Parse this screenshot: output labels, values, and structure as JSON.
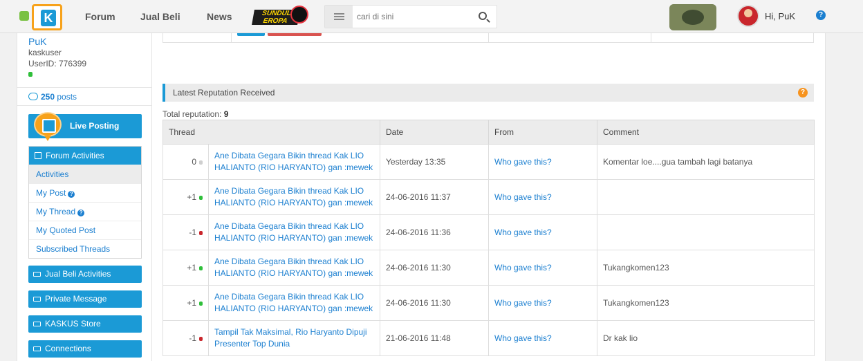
{
  "header": {
    "logo_icon": "kaskus-logo",
    "nav": [
      "Forum",
      "Jual Beli",
      "News"
    ],
    "promo_text": "SUNDUL EROPA",
    "search": {
      "placeholder": "cari di sini"
    },
    "greeting": "Hi, PuK",
    "help_icon": "?"
  },
  "sidebar": {
    "username": "PuK",
    "rank": "kaskuser",
    "user_id": "UserID: 776399",
    "posts_count": "250",
    "posts_label": "posts",
    "live_posting": "Live Posting",
    "forum_activities": {
      "title": "Forum Activities",
      "items": [
        "Activities",
        "My Post",
        "My Thread",
        "My Quoted Post",
        "Subscribed Threads"
      ]
    },
    "buttons": [
      "Jual Beli Activities",
      "Private Message",
      "KASKUS Store",
      "Connections"
    ]
  },
  "main": {
    "section_title": "Latest Reputation Received",
    "total_label": "Total reputation:",
    "total_value": "9",
    "columns": [
      "Thread",
      "Date",
      "From",
      "Comment"
    ],
    "rows": [
      {
        "score": "0",
        "status": "gray",
        "thread": "Ane Dibata Gegara Bikin thread Kak LIO HALIANTO (RIO HARYANTO) gan :mewek",
        "date": "Yesterday 13:35",
        "from": "Who gave this?",
        "comment": "Komentar loe....gua tambah lagi batanya"
      },
      {
        "score": "+1",
        "status": "green",
        "thread": "Ane Dibata Gegara Bikin thread Kak LIO HALIANTO (RIO HARYANTO) gan :mewek",
        "date": "24-06-2016 11:37",
        "from": "Who gave this?",
        "comment": ""
      },
      {
        "score": "-1",
        "status": "red",
        "thread": "Ane Dibata Gegara Bikin thread Kak LIO HALIANTO (RIO HARYANTO) gan :mewek",
        "date": "24-06-2016 11:36",
        "from": "Who gave this?",
        "comment": ""
      },
      {
        "score": "+1",
        "status": "green",
        "thread": "Ane Dibata Gegara Bikin thread Kak LIO HALIANTO (RIO HARYANTO) gan :mewek",
        "date": "24-06-2016 11:30",
        "from": "Who gave this?",
        "comment": "Tukangkomen123"
      },
      {
        "score": "+1",
        "status": "green",
        "thread": "Ane Dibata Gegara Bikin thread Kak LIO HALIANTO (RIO HARYANTO) gan :mewek",
        "date": "24-06-2016 11:30",
        "from": "Who gave this?",
        "comment": "Tukangkomen123"
      },
      {
        "score": "-1",
        "status": "red",
        "thread": "Tampil Tak Maksimal, Rio Haryanto Dipuji Presenter Top Dunia",
        "date": "21-06-2016 11:48",
        "from": "Who gave this?",
        "comment": "Dr kak lio"
      }
    ]
  },
  "colors": {
    "accent": "#1b9ad6",
    "link": "#1b7fd0",
    "positive": "#2fbf3a",
    "negative": "#c9262c",
    "neutral": "#cfcfcf"
  }
}
